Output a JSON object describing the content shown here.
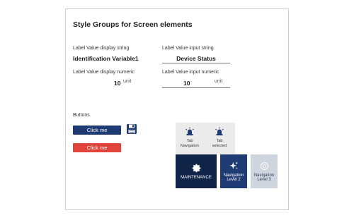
{
  "card": {
    "title": "Style Groups for Screen elements"
  },
  "fields": {
    "display_string_label": "Label Value display string",
    "display_string_value": "Identification Variable1",
    "input_string_label": "Label Value input string",
    "input_string_value": "Device Status",
    "display_numeric_label": "Label Value display numeric",
    "display_numeric_value": "10",
    "display_numeric_unit": "unit",
    "input_numeric_label": "Label Value input numeric",
    "input_numeric_value": "10",
    "input_numeric_unit": "unit"
  },
  "buttons": {
    "section_label": "Buttons",
    "primary_label": "Click me",
    "danger_label": "Click me",
    "save_icon": "floppy-disk-icon"
  },
  "tabs": [
    {
      "label_line1": "Tab",
      "label_line2": "Navigation",
      "icon": "alarm-beacon-icon"
    },
    {
      "label_line1": "Tab",
      "label_line2": "selected",
      "icon": "alarm-beacon-icon"
    }
  ],
  "nav_tiles": [
    {
      "label_line1": "MAINTENANCE",
      "label_line2": "",
      "icon": "gear-icon",
      "bg": "#0f2447",
      "fg": "#ffffff"
    },
    {
      "label_line1": "Navigation",
      "label_line2": "Level 2",
      "icon": "sparkle-icon",
      "bg": "#1f3b73",
      "fg": "#ffffff"
    },
    {
      "label_line1": "Navigation",
      "label_line2": "Level 3",
      "icon": "circle-icon",
      "bg": "#cfd5df",
      "fg": "#2b3a55"
    }
  ],
  "colors": {
    "primary": "#1f3b73",
    "danger": "#e0443a",
    "dark_tile": "#0f2447"
  }
}
